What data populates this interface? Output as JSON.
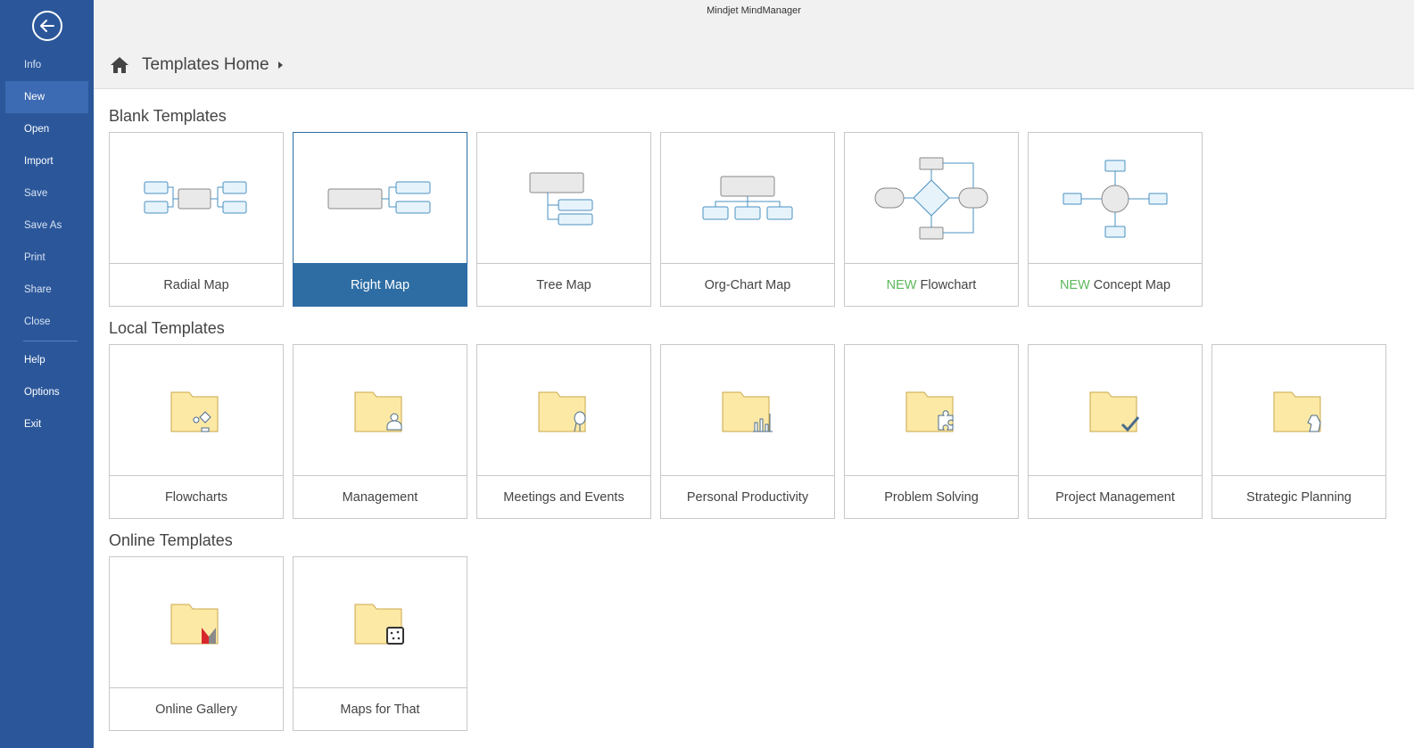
{
  "app": {
    "title": "Mindjet MindManager"
  },
  "breadcrumb": {
    "label": "Templates Home"
  },
  "sidebar": {
    "items": [
      {
        "key": "info",
        "label": "Info"
      },
      {
        "key": "new",
        "label": "New"
      },
      {
        "key": "open",
        "label": "Open"
      },
      {
        "key": "import",
        "label": "Import"
      },
      {
        "key": "save",
        "label": "Save"
      },
      {
        "key": "save-as",
        "label": "Save As"
      },
      {
        "key": "print",
        "label": "Print"
      },
      {
        "key": "share",
        "label": "Share"
      },
      {
        "key": "close",
        "label": "Close"
      },
      {
        "key": "help",
        "label": "Help"
      },
      {
        "key": "options",
        "label": "Options"
      },
      {
        "key": "exit",
        "label": "Exit"
      }
    ],
    "selected": "new"
  },
  "sections": {
    "blank": {
      "title": "Blank Templates",
      "tiles": [
        {
          "label": "Radial Map"
        },
        {
          "label": "Right Map"
        },
        {
          "label": "Tree Map"
        },
        {
          "label": "Org-Chart Map"
        },
        {
          "badge": "NEW",
          "label": "Flowchart"
        },
        {
          "badge": "NEW",
          "label": "Concept Map"
        }
      ]
    },
    "local": {
      "title": "Local Templates",
      "tiles": [
        {
          "label": "Flowcharts"
        },
        {
          "label": "Management"
        },
        {
          "label": "Meetings and Events"
        },
        {
          "label": "Personal Productivity"
        },
        {
          "label": "Problem Solving"
        },
        {
          "label": "Project Management"
        },
        {
          "label": "Strategic Planning"
        }
      ]
    },
    "online": {
      "title": "Online Templates",
      "tiles": [
        {
          "label": "Online Gallery"
        },
        {
          "label": "Maps for That"
        }
      ]
    }
  },
  "colors": {
    "sidebar": "#2b579a",
    "selected_tile": "#2e6da4",
    "new_badge": "#5cb85c",
    "folder": "#fde9a6"
  }
}
